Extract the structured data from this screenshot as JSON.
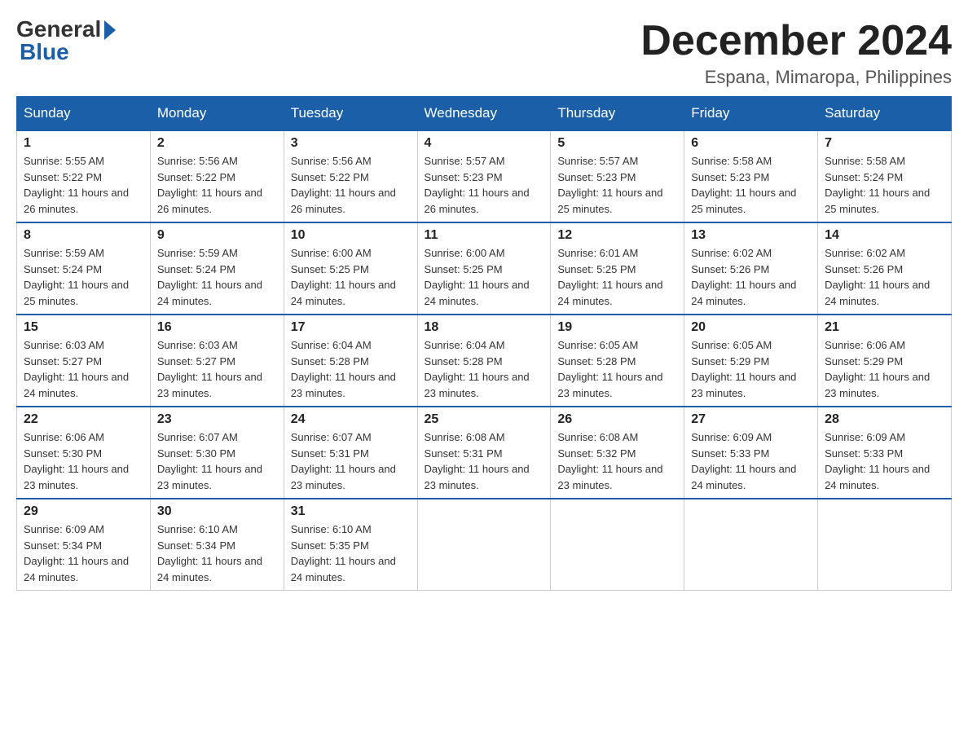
{
  "logo": {
    "general": "General",
    "blue": "Blue"
  },
  "header": {
    "month": "December 2024",
    "location": "Espana, Mimaropa, Philippines"
  },
  "weekdays": [
    "Sunday",
    "Monday",
    "Tuesday",
    "Wednesday",
    "Thursday",
    "Friday",
    "Saturday"
  ],
  "weeks": [
    [
      {
        "day": "1",
        "sunrise": "5:55 AM",
        "sunset": "5:22 PM",
        "daylight": "11 hours and 26 minutes."
      },
      {
        "day": "2",
        "sunrise": "5:56 AM",
        "sunset": "5:22 PM",
        "daylight": "11 hours and 26 minutes."
      },
      {
        "day": "3",
        "sunrise": "5:56 AM",
        "sunset": "5:22 PM",
        "daylight": "11 hours and 26 minutes."
      },
      {
        "day": "4",
        "sunrise": "5:57 AM",
        "sunset": "5:23 PM",
        "daylight": "11 hours and 26 minutes."
      },
      {
        "day": "5",
        "sunrise": "5:57 AM",
        "sunset": "5:23 PM",
        "daylight": "11 hours and 25 minutes."
      },
      {
        "day": "6",
        "sunrise": "5:58 AM",
        "sunset": "5:23 PM",
        "daylight": "11 hours and 25 minutes."
      },
      {
        "day": "7",
        "sunrise": "5:58 AM",
        "sunset": "5:24 PM",
        "daylight": "11 hours and 25 minutes."
      }
    ],
    [
      {
        "day": "8",
        "sunrise": "5:59 AM",
        "sunset": "5:24 PM",
        "daylight": "11 hours and 25 minutes."
      },
      {
        "day": "9",
        "sunrise": "5:59 AM",
        "sunset": "5:24 PM",
        "daylight": "11 hours and 24 minutes."
      },
      {
        "day": "10",
        "sunrise": "6:00 AM",
        "sunset": "5:25 PM",
        "daylight": "11 hours and 24 minutes."
      },
      {
        "day": "11",
        "sunrise": "6:00 AM",
        "sunset": "5:25 PM",
        "daylight": "11 hours and 24 minutes."
      },
      {
        "day": "12",
        "sunrise": "6:01 AM",
        "sunset": "5:25 PM",
        "daylight": "11 hours and 24 minutes."
      },
      {
        "day": "13",
        "sunrise": "6:02 AM",
        "sunset": "5:26 PM",
        "daylight": "11 hours and 24 minutes."
      },
      {
        "day": "14",
        "sunrise": "6:02 AM",
        "sunset": "5:26 PM",
        "daylight": "11 hours and 24 minutes."
      }
    ],
    [
      {
        "day": "15",
        "sunrise": "6:03 AM",
        "sunset": "5:27 PM",
        "daylight": "11 hours and 24 minutes."
      },
      {
        "day": "16",
        "sunrise": "6:03 AM",
        "sunset": "5:27 PM",
        "daylight": "11 hours and 23 minutes."
      },
      {
        "day": "17",
        "sunrise": "6:04 AM",
        "sunset": "5:28 PM",
        "daylight": "11 hours and 23 minutes."
      },
      {
        "day": "18",
        "sunrise": "6:04 AM",
        "sunset": "5:28 PM",
        "daylight": "11 hours and 23 minutes."
      },
      {
        "day": "19",
        "sunrise": "6:05 AM",
        "sunset": "5:28 PM",
        "daylight": "11 hours and 23 minutes."
      },
      {
        "day": "20",
        "sunrise": "6:05 AM",
        "sunset": "5:29 PM",
        "daylight": "11 hours and 23 minutes."
      },
      {
        "day": "21",
        "sunrise": "6:06 AM",
        "sunset": "5:29 PM",
        "daylight": "11 hours and 23 minutes."
      }
    ],
    [
      {
        "day": "22",
        "sunrise": "6:06 AM",
        "sunset": "5:30 PM",
        "daylight": "11 hours and 23 minutes."
      },
      {
        "day": "23",
        "sunrise": "6:07 AM",
        "sunset": "5:30 PM",
        "daylight": "11 hours and 23 minutes."
      },
      {
        "day": "24",
        "sunrise": "6:07 AM",
        "sunset": "5:31 PM",
        "daylight": "11 hours and 23 minutes."
      },
      {
        "day": "25",
        "sunrise": "6:08 AM",
        "sunset": "5:31 PM",
        "daylight": "11 hours and 23 minutes."
      },
      {
        "day": "26",
        "sunrise": "6:08 AM",
        "sunset": "5:32 PM",
        "daylight": "11 hours and 23 minutes."
      },
      {
        "day": "27",
        "sunrise": "6:09 AM",
        "sunset": "5:33 PM",
        "daylight": "11 hours and 24 minutes."
      },
      {
        "day": "28",
        "sunrise": "6:09 AM",
        "sunset": "5:33 PM",
        "daylight": "11 hours and 24 minutes."
      }
    ],
    [
      {
        "day": "29",
        "sunrise": "6:09 AM",
        "sunset": "5:34 PM",
        "daylight": "11 hours and 24 minutes."
      },
      {
        "day": "30",
        "sunrise": "6:10 AM",
        "sunset": "5:34 PM",
        "daylight": "11 hours and 24 minutes."
      },
      {
        "day": "31",
        "sunrise": "6:10 AM",
        "sunset": "5:35 PM",
        "daylight": "11 hours and 24 minutes."
      },
      null,
      null,
      null,
      null
    ]
  ]
}
